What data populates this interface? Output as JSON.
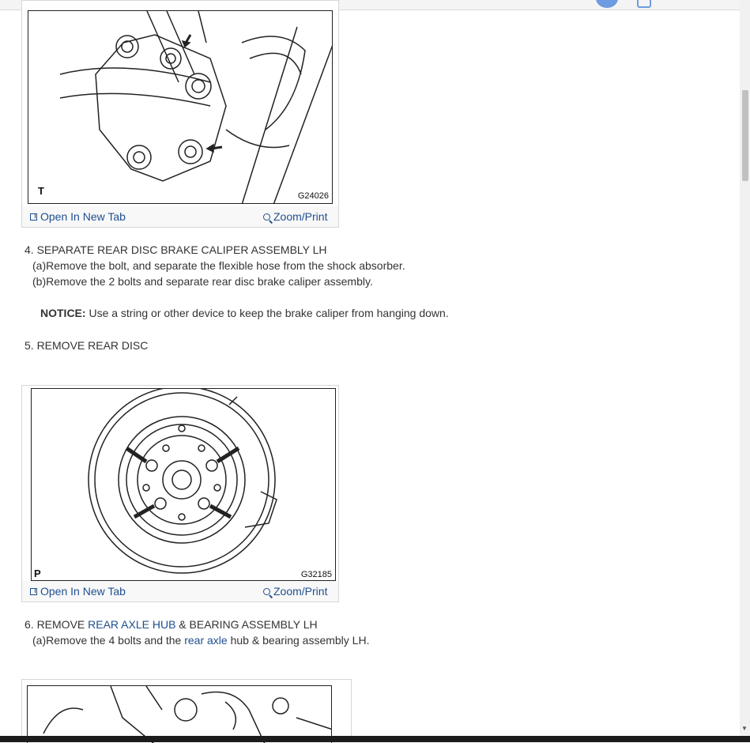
{
  "figures": [
    {
      "letter": "T",
      "code": "G24026",
      "open_tab_label": "Open In New Tab",
      "zoom_label": "Zoom/Print"
    },
    {
      "letter": "P",
      "code": "G32185",
      "open_tab_label": "Open In New Tab",
      "zoom_label": "Zoom/Print"
    }
  ],
  "steps": {
    "step4": {
      "heading": "4. SEPARATE REAR DISC BRAKE CALIPER ASSEMBLY LH",
      "a": "(a)Remove the bolt, and separate the flexible hose from the shock absorber.",
      "b": "(b)Remove the 2 bolts and separate rear disc brake caliper assembly.",
      "notice_label": "NOTICE:",
      "notice_text": " Use a string or other device to keep the brake caliper from hanging down."
    },
    "step5": {
      "heading": "5. REMOVE REAR DISC"
    },
    "step6": {
      "heading_prefix": "6. REMOVE ",
      "heading_link": "REAR AXLE HUB",
      "heading_suffix": " & BEARING ASSEMBLY LH",
      "a_prefix": "(a)Remove the 4 bolts and the ",
      "a_link": "rear axle",
      "a_suffix": " hub & bearing assembly LH."
    }
  },
  "colors": {
    "link": "#1f4f8f",
    "text": "#333333"
  }
}
